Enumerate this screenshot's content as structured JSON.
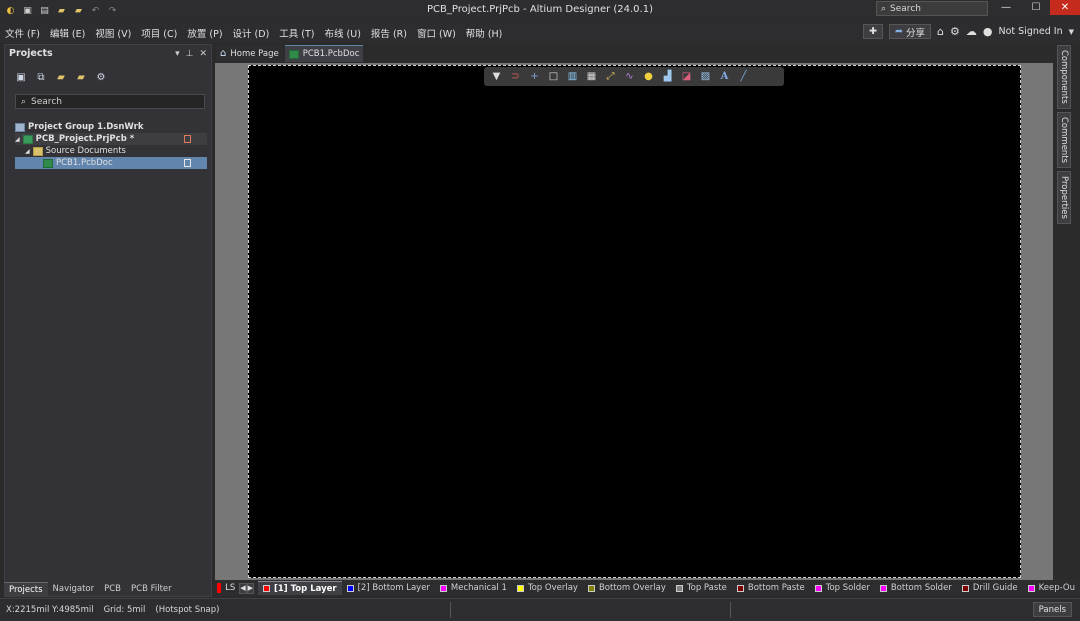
{
  "titlebar": {
    "title": "PCB_Project.PrjPcb - Altium Designer (24.0.1)",
    "search_placeholder": "Search"
  },
  "menu": {
    "items": [
      "文件 (F)",
      "编辑 (E)",
      "视图 (V)",
      "项目 (C)",
      "放置 (P)",
      "设计 (D)",
      "工具 (T)",
      "布线 (U)",
      "报告 (R)",
      "窗口 (W)",
      "帮助 (H)"
    ],
    "share_label": "分享",
    "account_label": "Not Signed In"
  },
  "projects_panel": {
    "title": "Projects",
    "search_placeholder": "Search",
    "tree": {
      "group": "Project Group 1.DsnWrk",
      "project": "PCB_Project.PrjPcb *",
      "folder": "Source Documents",
      "document": "PCB1.PcbDoc"
    },
    "tabs": [
      "Projects",
      "Navigator",
      "PCB",
      "PCB Filter"
    ]
  },
  "doc_tabs": [
    "Home Page",
    "PCB1.PcbDoc"
  ],
  "right_tabs": [
    "Components",
    "Comments",
    "Properties"
  ],
  "layers": {
    "ls_label": "LS",
    "items": [
      {
        "name": "[1] Top Layer",
        "color": "#ff0000"
      },
      {
        "name": "[2] Bottom Layer",
        "color": "#0000ff"
      },
      {
        "name": "Mechanical 1",
        "color": "#ff00ff"
      },
      {
        "name": "Top Overlay",
        "color": "#ffff00"
      },
      {
        "name": "Bottom Overlay",
        "color": "#808000"
      },
      {
        "name": "Top Paste",
        "color": "#808080"
      },
      {
        "name": "Bottom Paste",
        "color": "#800000"
      },
      {
        "name": "Top Solder",
        "color": "#ff00ff"
      },
      {
        "name": "Bottom Solder",
        "color": "#ff00ff"
      },
      {
        "name": "Drill Guide",
        "color": "#800000"
      },
      {
        "name": "Keep-Ou",
        "color": "#ff00ff"
      }
    ]
  },
  "status": {
    "coords": "X:2215mil Y:4985mil",
    "grid": "Grid: 5mil",
    "snap": "(Hotspot Snap)",
    "panels_label": "Panels"
  }
}
